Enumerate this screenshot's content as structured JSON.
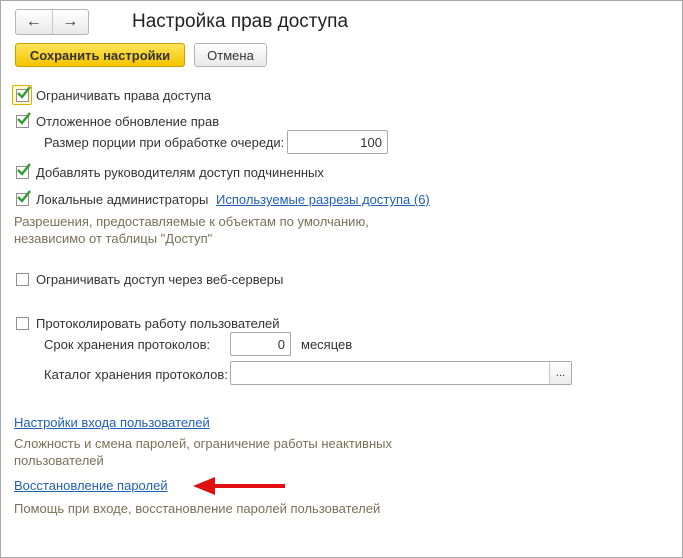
{
  "header": {
    "title": "Настройка прав доступа",
    "back_icon": "←",
    "forward_icon": "→"
  },
  "toolbar": {
    "save_label": "Сохранить настройки",
    "cancel_label": "Отмена"
  },
  "settings": {
    "restrict_rights": {
      "label": "Ограничивать права доступа",
      "checked": true
    },
    "deferred_update": {
      "label": "Отложенное обновление прав",
      "checked": true
    },
    "queue_portion": {
      "label": "Размер порции при обработке очереди:",
      "value": "100"
    },
    "managers_access": {
      "label": "Добавлять руководителям доступ подчиненных",
      "checked": true
    },
    "local_admins": {
      "label": "Локальные администраторы",
      "checked": true,
      "link": "Используемые разрезы доступа (6)"
    },
    "local_admins_hint_line1": "Разрешения, предоставляемые к объектам по умолчанию,",
    "local_admins_hint_line2": "независимо от таблицы \"Доступ\"",
    "web_servers": {
      "label": "Ограничивать доступ через веб-серверы",
      "checked": false
    },
    "log_users": {
      "label": "Протоколировать работу пользователей",
      "checked": false
    },
    "log_retention": {
      "label": "Срок хранения протоколов:",
      "value": "0",
      "unit": "месяцев"
    },
    "log_catalog": {
      "label": "Каталог хранения протоколов:",
      "value": "",
      "button": "..."
    }
  },
  "links": {
    "login_settings": "Настройки входа пользователей",
    "login_settings_hint_line1": "Сложность и смена паролей, ограничение работы неактивных",
    "login_settings_hint_line2": "пользователей",
    "password_recovery": "Восстановление паролей",
    "password_recovery_hint": "Помощь при входе, восстановление паролей пользователей"
  },
  "colors": {
    "accent_yellow": "#f5c400",
    "link_blue": "#1f5fb5",
    "hint_text": "#7a7058",
    "check_green": "#2e9e2e",
    "arrow_red": "#e01010"
  }
}
